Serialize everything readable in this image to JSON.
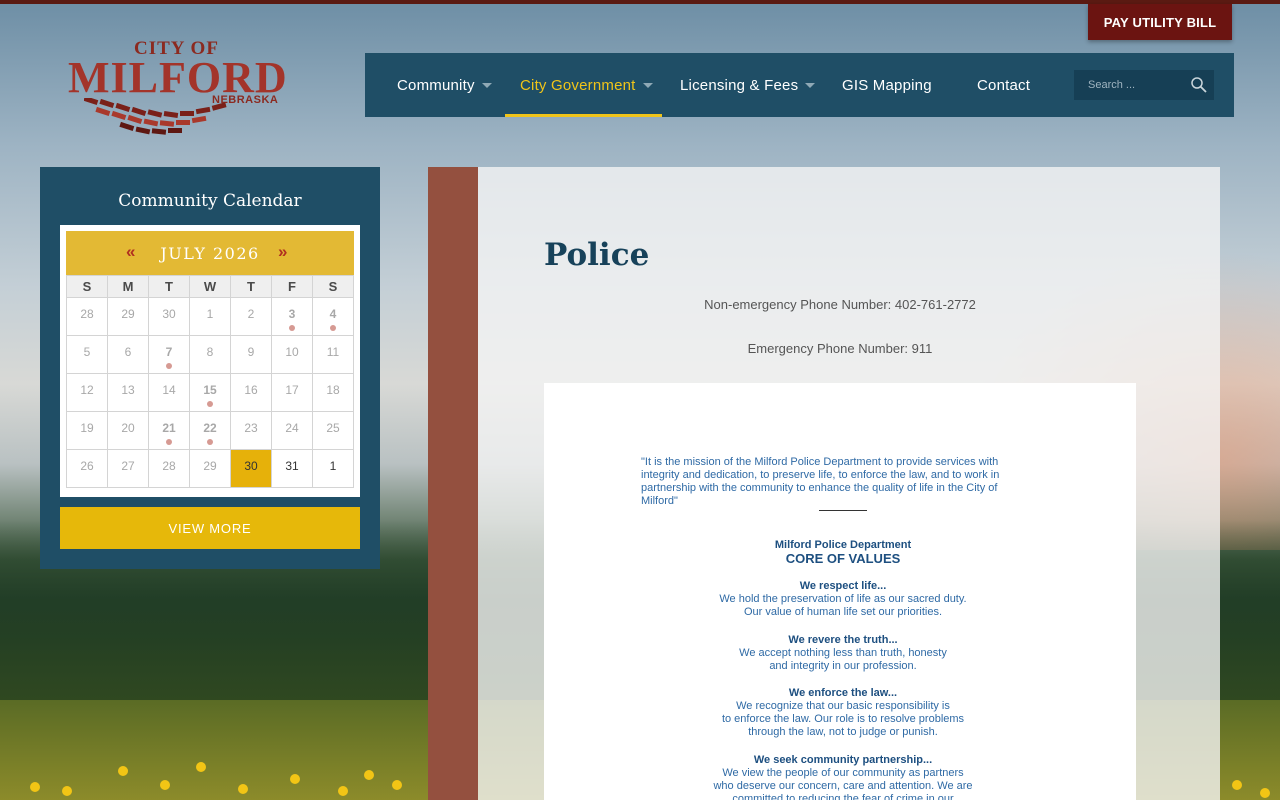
{
  "header": {
    "pay_button": "PAY UTILITY BILL",
    "logo": {
      "city_of": "CITY OF",
      "name": "MILFORD",
      "state": "NEBRASKA"
    }
  },
  "nav": {
    "items": [
      {
        "label": "Community",
        "has_dropdown": true,
        "active": false
      },
      {
        "label": "City Government",
        "has_dropdown": true,
        "active": true
      },
      {
        "label": "Licensing & Fees",
        "has_dropdown": true,
        "active": false
      },
      {
        "label": "GIS Mapping",
        "has_dropdown": false,
        "active": false
      },
      {
        "label": "Contact",
        "has_dropdown": false,
        "active": false
      }
    ],
    "search_placeholder": "Search ..."
  },
  "calendar": {
    "title": "Community Calendar",
    "prev": "«",
    "next": "»",
    "month": "JULY 2026",
    "days_of_week": [
      "S",
      "M",
      "T",
      "W",
      "T",
      "F",
      "S"
    ],
    "weeks": [
      [
        {
          "d": "28"
        },
        {
          "d": "29"
        },
        {
          "d": "30"
        },
        {
          "d": "1"
        },
        {
          "d": "2"
        },
        {
          "d": "3",
          "event": true
        },
        {
          "d": "4",
          "event": true
        }
      ],
      [
        {
          "d": "5"
        },
        {
          "d": "6"
        },
        {
          "d": "7",
          "event": true
        },
        {
          "d": "8"
        },
        {
          "d": "9"
        },
        {
          "d": "10"
        },
        {
          "d": "11"
        }
      ],
      [
        {
          "d": "12"
        },
        {
          "d": "13"
        },
        {
          "d": "14"
        },
        {
          "d": "15",
          "event": true
        },
        {
          "d": "16"
        },
        {
          "d": "17"
        },
        {
          "d": "18"
        }
      ],
      [
        {
          "d": "19"
        },
        {
          "d": "20"
        },
        {
          "d": "21",
          "event": true
        },
        {
          "d": "22",
          "event": true
        },
        {
          "d": "23"
        },
        {
          "d": "24"
        },
        {
          "d": "25"
        }
      ],
      [
        {
          "d": "26"
        },
        {
          "d": "27"
        },
        {
          "d": "28"
        },
        {
          "d": "29"
        },
        {
          "d": "30",
          "today": true
        },
        {
          "d": "31",
          "current": true
        },
        {
          "d": "1",
          "current": true
        }
      ]
    ],
    "view_more": "VIEW MORE"
  },
  "content": {
    "title": "Police",
    "non_emergency": "Non-emergency Phone Number: 402-761-2772",
    "emergency": "Emergency Phone Number: 911",
    "document": {
      "mission": "\"It is the mission of the Milford Police Department to provide services with integrity and dedication, to preserve life, to enforce the law, and to work in partnership with the community to enhance the quality of life in the City of Milford\"",
      "dept": "Milford Police Department",
      "core": "CORE OF VALUES",
      "values": [
        {
          "head": "We respect life...",
          "lines": [
            "We hold the preservation of life as our sacred duty.",
            "Our value of human life set our priorities."
          ]
        },
        {
          "head": "We revere the truth...",
          "lines": [
            "We accept nothing less than truth, honesty",
            "and integrity in our profession."
          ]
        },
        {
          "head": "We enforce the law...",
          "lines": [
            "We recognize that our basic responsibility is",
            "to enforce the law.  Our role is to resolve problems",
            "through the law, not to judge or punish."
          ]
        },
        {
          "head": "We seek community partnership...",
          "lines": [
            "We view the people of our community as partners",
            "who deserve our concern, care and attention.  We are",
            "committed to reducing the fear of crime in our"
          ]
        }
      ]
    }
  }
}
